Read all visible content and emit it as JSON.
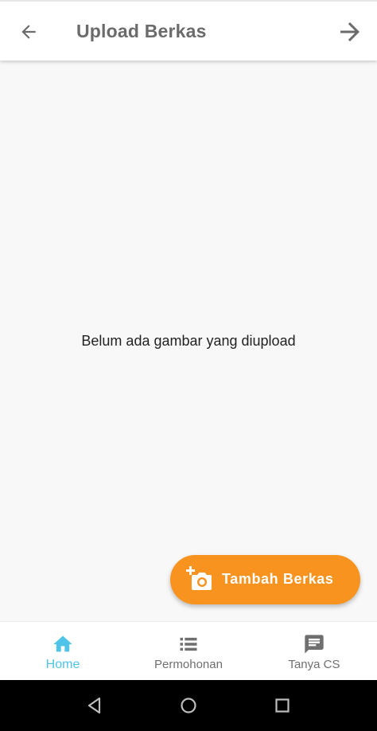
{
  "appbar": {
    "title": "Upload Berkas",
    "back_icon": "arrow-left-icon",
    "next_icon": "arrow-right-icon"
  },
  "content": {
    "empty_message": "Belum ada gambar yang diupload"
  },
  "fab": {
    "label": "Tambah Berkas",
    "icon": "add-photo-icon",
    "color": "#f7931e"
  },
  "bottom_nav": {
    "items": [
      {
        "label": "Home",
        "icon": "home-icon",
        "active": true
      },
      {
        "label": "Permohonan",
        "icon": "list-icon",
        "active": false
      },
      {
        "label": "Tanya CS",
        "icon": "chat-icon",
        "active": false
      }
    ],
    "active_color": "#4fc3e8",
    "inactive_color": "#6f6f6f"
  },
  "system_nav": {
    "buttons": [
      "back-triangle-icon",
      "home-circle-icon",
      "recents-square-icon"
    ]
  }
}
